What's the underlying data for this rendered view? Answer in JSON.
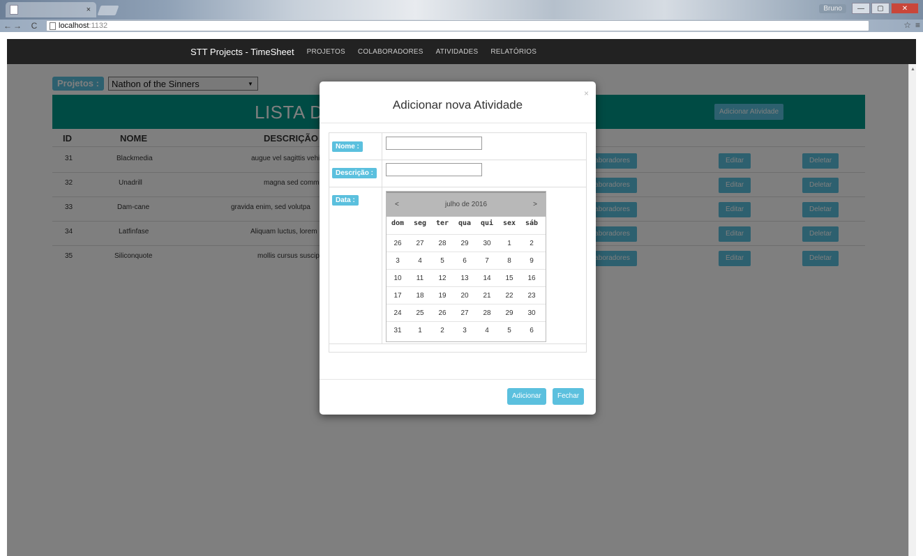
{
  "browser": {
    "tab_close": "×",
    "user_badge": "Bruno",
    "url_host": "localhost",
    "url_port": ":1132",
    "win_minimize": "—",
    "win_maximize": "▢",
    "win_close": "✕",
    "back": "←",
    "forward": "→",
    "reload": "C",
    "star": "☆",
    "menu": "≡"
  },
  "navbar": {
    "brand": "STT Projects - TimeSheet",
    "links": [
      "PROJETOS",
      "COLABORADORES",
      "ATIVIDADES",
      "RELATÓRIOS"
    ]
  },
  "filter": {
    "label": "Projetos :",
    "selected": "Nathon of the Sinners"
  },
  "banner": {
    "title": "LISTA D",
    "add_button": "Adicionar Atividade"
  },
  "table": {
    "headers": [
      "ID",
      "NOME",
      "DESCRIÇÃO"
    ],
    "rows": [
      {
        "id": "31",
        "nome": "Blackmedia",
        "descricao": "augue vel sagittis vehi",
        "collab": "laboradores",
        "edit": "Editar",
        "delete": "Deletar"
      },
      {
        "id": "32",
        "nome": "Unadrill",
        "descricao": "magna sed commod",
        "collab": "laboradores",
        "edit": "Editar",
        "delete": "Deletar"
      },
      {
        "id": "33",
        "nome": "Dam-cane",
        "descricao": "gravida enim, sed volutpa",
        "collab": "laboradores",
        "edit": "Editar",
        "delete": "Deletar"
      },
      {
        "id": "34",
        "nome": "Latfinfase",
        "descricao": "Aliquam luctus, lorem",
        "collab": "laboradores",
        "edit": "Editar",
        "delete": "Deletar"
      },
      {
        "id": "35",
        "nome": "Siliconquote",
        "descricao": "mollis cursus suscip",
        "collab": "laboradores",
        "edit": "Editar",
        "delete": "Deletar"
      }
    ]
  },
  "modal": {
    "title": "Adicionar nova Atividade",
    "close_x": "×",
    "fields": {
      "nome_label": "Nome :",
      "nome_value": "",
      "descricao_label": "Descrição :",
      "descricao_value": "",
      "data_label": "Data :"
    },
    "calendar": {
      "prev": "<",
      "next": ">",
      "month_label": "julho de 2016",
      "weekdays": [
        "dom",
        "seg",
        "ter",
        "qua",
        "qui",
        "sex",
        "sáb"
      ],
      "weeks": [
        [
          "26",
          "27",
          "28",
          "29",
          "30",
          "1",
          "2"
        ],
        [
          "3",
          "4",
          "5",
          "6",
          "7",
          "8",
          "9"
        ],
        [
          "10",
          "11",
          "12",
          "13",
          "14",
          "15",
          "16"
        ],
        [
          "17",
          "18",
          "19",
          "20",
          "21",
          "22",
          "23"
        ],
        [
          "24",
          "25",
          "26",
          "27",
          "28",
          "29",
          "30"
        ],
        [
          "31",
          "1",
          "2",
          "3",
          "4",
          "5",
          "6"
        ]
      ]
    },
    "buttons": {
      "add": "Adicionar",
      "close": "Fechar"
    }
  },
  "colors": {
    "navbar_bg": "#222222",
    "banner_bg": "#009688",
    "info_button": "#5bc0de",
    "overlay": "rgba(0,0,0,0.5)"
  }
}
